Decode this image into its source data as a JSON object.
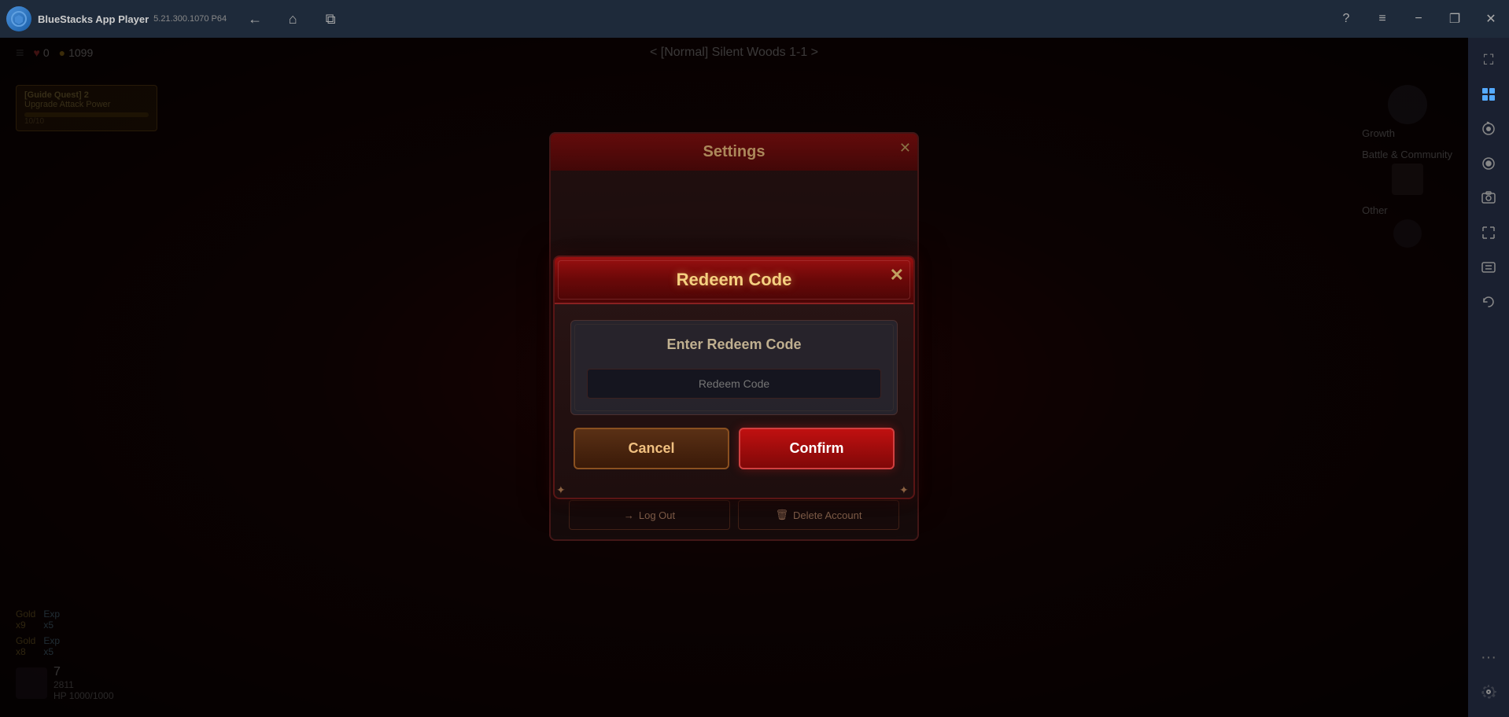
{
  "titlebar": {
    "app_name": "BlueStacks App Player",
    "version": "5.21.300.1070  P64",
    "logo_text": "BS",
    "btn_help": "?",
    "btn_menu": "≡",
    "btn_minimize": "−",
    "btn_restore": "❐",
    "btn_close": "✕",
    "btn_back": "←",
    "btn_home": "⌂",
    "btn_copy": "⧉"
  },
  "hud": {
    "stage_title": "< [Normal] Silent Woods 1-1 >",
    "hearts": "0",
    "coins": "1099",
    "heart_icon": "♥",
    "coin_icon": "●"
  },
  "sidebar_right": {
    "icons": [
      {
        "name": "expand-icon",
        "symbol": "⛶"
      },
      {
        "name": "layout-icon",
        "symbol": "▦"
      },
      {
        "name": "camera-rotate-icon",
        "symbol": "↺"
      },
      {
        "name": "record-icon",
        "symbol": "●"
      },
      {
        "name": "screenshot-icon",
        "symbol": "📷"
      },
      {
        "name": "resize-icon",
        "symbol": "⤡"
      },
      {
        "name": "screenshot2-icon",
        "symbol": "⊕"
      },
      {
        "name": "refresh-icon",
        "symbol": "↻"
      },
      {
        "name": "settings-icon",
        "symbol": "⚙"
      }
    ]
  },
  "settings_modal": {
    "title": "Settings",
    "close_symbol": "✕",
    "log_out_label": "Log Out",
    "delete_account_label": "Delete Account",
    "logout_icon": "→",
    "delete_icon": "🗑"
  },
  "redeem_modal": {
    "title": "Redeem Code",
    "close_symbol": "✕",
    "placeholder_text": "Enter Redeem Code",
    "input_placeholder": "Redeem Code",
    "cancel_label": "Cancel",
    "confirm_label": "Confirm"
  },
  "quest": {
    "title": "[Guide Quest] 2",
    "description": "Upgrade Attack Power",
    "progress": "10/10"
  },
  "right_panel": {
    "growth_label": "Growth",
    "battle_community_label": "Battle & Community",
    "other_label": "Other"
  },
  "bottom_left": {
    "gold_label": "Gold",
    "gold_amount": "x9",
    "exp_label": "Exp",
    "exp_amount": "x5",
    "gold2_label": "Gold",
    "gold2_amount": "x8",
    "exp2_label": "Exp",
    "exp2_amount": "x5",
    "level": "7",
    "hp": "2811",
    "hp_label": "HP 1000/1000"
  },
  "colors": {
    "accent_red": "#c01010",
    "accent_gold": "#f0c080",
    "border_dark": "#5a1515",
    "bg_dark": "#1e0e0e",
    "btn_cancel_bg": "#5a3015",
    "btn_confirm_bg": "#c01010"
  }
}
